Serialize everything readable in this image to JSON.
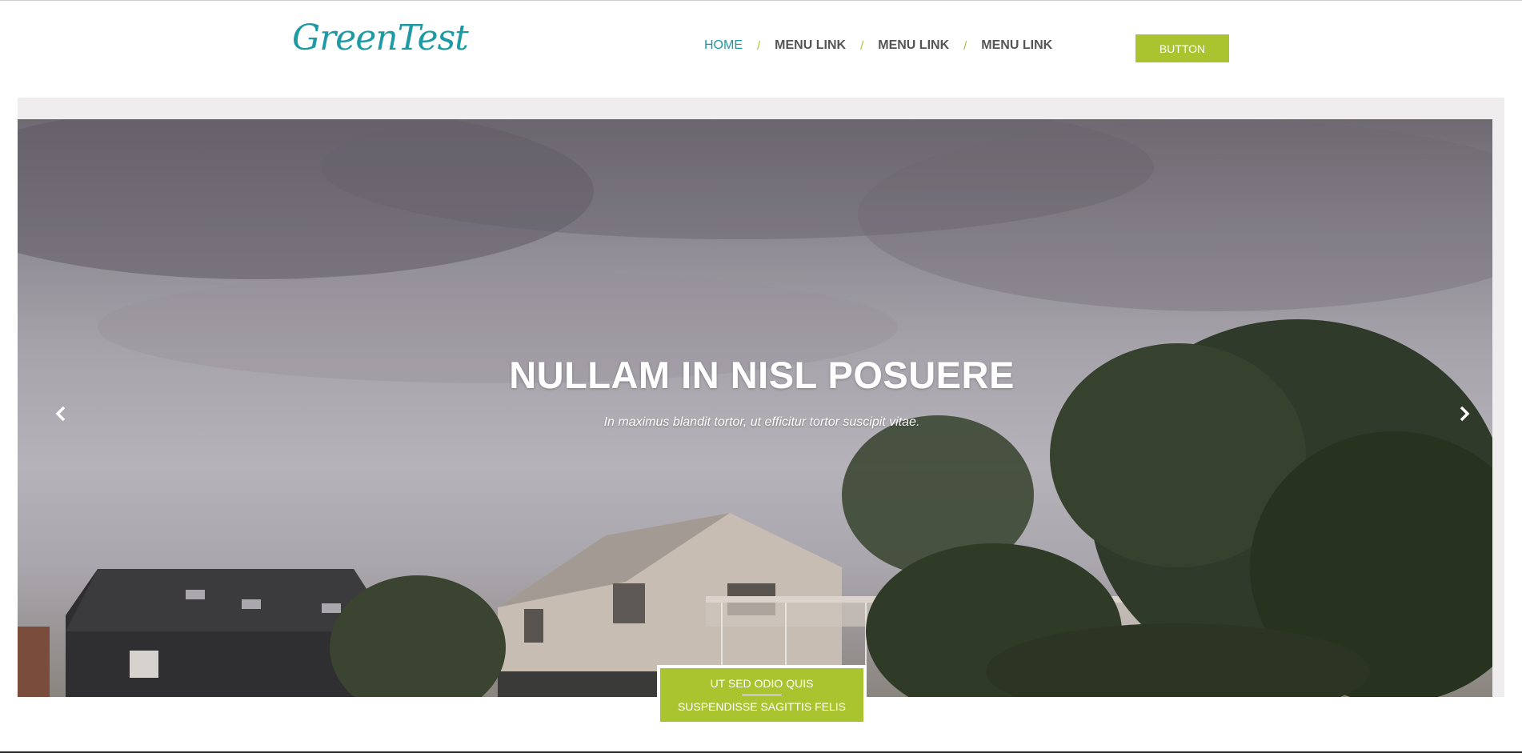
{
  "header": {
    "logo_text": "GreenTest",
    "nav": [
      {
        "label": "HOME",
        "active": true
      },
      {
        "label": "MENU LINK",
        "active": false
      },
      {
        "label": "MENU LINK",
        "active": false
      },
      {
        "label": "MENU LINK",
        "active": false
      }
    ],
    "nav_separator": "/",
    "button_label": "BUTTON"
  },
  "hero": {
    "title": "NULLAM IN NISL POSUERE",
    "subtitle": "In maximus blandit tortor, ut efficitur tortor suscipit vitae.",
    "prev_icon": "chevron-left-icon",
    "next_icon": "chevron-right-icon"
  },
  "cta": {
    "line1": "UT SED ODIO QUIS",
    "line2": "SUSPENDISSE SAGITTIS FELIS"
  },
  "colors": {
    "accent_green": "#a9c42f",
    "brand_teal": "#1d9aa3",
    "nav_text": "#555555"
  }
}
